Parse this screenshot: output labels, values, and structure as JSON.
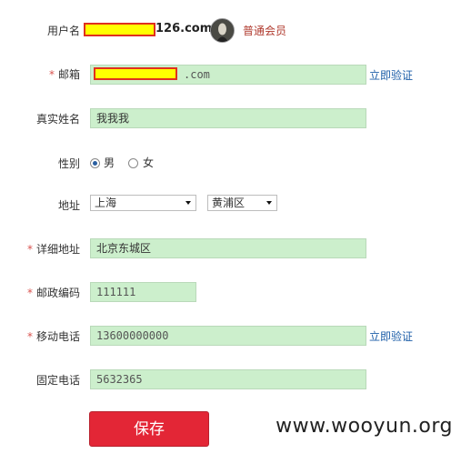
{
  "form": {
    "username_label": "用户名",
    "username_suffix": "126.com",
    "member_level": "普通会员",
    "required_mark": "*",
    "email_label": "邮箱",
    "email_suffix": ".com",
    "verify_email_link": "立即验证",
    "realname_label": "真实姓名",
    "realname_value": "我我我",
    "gender_label": "性别",
    "gender_male": "男",
    "gender_female": "女",
    "gender_selected": "男",
    "address_label": "地址",
    "province": "上海",
    "district": "黄浦区",
    "detail_address_label": "详细地址",
    "detail_address_value": "北京东城区",
    "postcode_label": "邮政编码",
    "postcode_value": "111111",
    "mobile_label": "移动电话",
    "mobile_value": "13600000000",
    "verify_mobile_link": "立即验证",
    "landline_label": "固定电话",
    "landline_value": "5632365",
    "save_label": "保存"
  },
  "watermark": "www.wooyun.org",
  "colors": {
    "input_bg": "#ccefcc",
    "link": "#1d5ea8",
    "member_level": "#b03a2e",
    "save_button": "#e32636",
    "redaction_fill": "#ffff00",
    "redaction_border": "#e0301e"
  }
}
